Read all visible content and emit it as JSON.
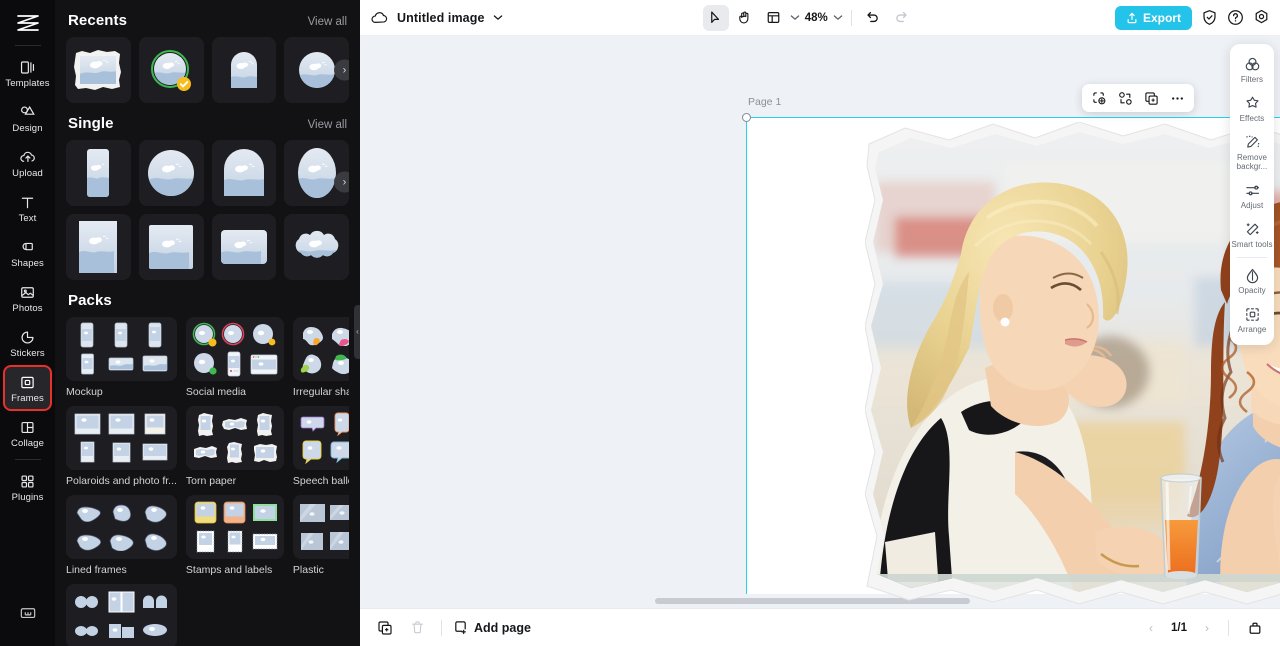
{
  "app": {
    "brand_icon": "logo-icon",
    "accent": "#24c3ea",
    "active_rail_highlight": "#e8312a"
  },
  "rail": {
    "items": [
      {
        "label": "Templates",
        "icon": "templates-icon",
        "active": false
      },
      {
        "label": "Design",
        "icon": "design-icon",
        "active": false
      },
      {
        "label": "Upload",
        "icon": "upload-cloud-icon",
        "active": false
      },
      {
        "label": "Text",
        "icon": "text-icon",
        "active": false
      },
      {
        "label": "Shapes",
        "icon": "shapes-icon",
        "active": false
      },
      {
        "label": "Photos",
        "icon": "photos-icon",
        "active": false
      },
      {
        "label": "Stickers",
        "icon": "stickers-icon",
        "active": false
      },
      {
        "label": "Frames",
        "icon": "frames-icon",
        "active": true
      },
      {
        "label": "Collage",
        "icon": "collage-icon",
        "active": false
      },
      {
        "label": "Plugins",
        "icon": "plugins-icon",
        "active": false
      }
    ],
    "bottom_icon": "keyboard-shortcuts-icon"
  },
  "panel": {
    "sections": [
      {
        "title": "Recents",
        "view_all": "View all",
        "items": [
          {
            "shape": "torn",
            "selected": false
          },
          {
            "shape": "circle-outline",
            "selected": true
          },
          {
            "shape": "arch",
            "selected": false
          },
          {
            "shape": "circle",
            "selected": false
          }
        ]
      },
      {
        "title": "Single",
        "view_all": "View all",
        "items": [
          {
            "shape": "rounded-tall"
          },
          {
            "shape": "circle"
          },
          {
            "shape": "arch"
          },
          {
            "shape": "oval"
          },
          {
            "shape": "square-tall"
          },
          {
            "shape": "square"
          },
          {
            "shape": "rounded-wide"
          },
          {
            "shape": "cloud"
          }
        ]
      }
    ],
    "packs_title": "Packs",
    "packs": [
      {
        "label": "Mockup"
      },
      {
        "label": "Social media"
      },
      {
        "label": "Irregular shape"
      },
      {
        "label": "Polaroids and photo fr..."
      },
      {
        "label": "Torn paper"
      },
      {
        "label": "Speech balloons"
      },
      {
        "label": "Lined frames"
      },
      {
        "label": "Stamps and labels"
      },
      {
        "label": "Plastic"
      }
    ]
  },
  "topbar": {
    "cloud_icon": "cloud-save-icon",
    "doc_title": "Untitled image",
    "title_chevron": "chevron-down-icon",
    "tools": [
      {
        "name": "select-tool",
        "icon": "cursor-icon",
        "selected": true
      },
      {
        "name": "hand-tool",
        "icon": "hand-icon",
        "selected": false
      },
      {
        "name": "layout-tool",
        "icon": "layout-icon",
        "selected": false
      }
    ],
    "zoom_value": "48%",
    "zoom_chevron": "chevron-down-icon",
    "undo": "undo-icon",
    "redo": "redo-icon",
    "export_label": "Export",
    "export_icon": "upload-icon",
    "shield_icon": "shield-check-icon",
    "help_icon": "help-circle-icon",
    "settings_icon": "gear-icon"
  },
  "canvas": {
    "page_label": "Page 1",
    "float_tools": [
      {
        "name": "crop-selection-tool",
        "icon": "crop-dashed-icon"
      },
      {
        "name": "replace-image-tool",
        "icon": "replace-icon"
      },
      {
        "name": "duplicate-tool",
        "icon": "duplicate-icon"
      },
      {
        "name": "more-options",
        "icon": "ellipsis-icon"
      }
    ],
    "rotate_icon": "rotate-icon",
    "selection_color": "#22d3ee",
    "image_description": "Two young women, one blonde and one redhead, smiling at a cafe table with two glasses of orange juice, inside a torn paper frame"
  },
  "right_panel": {
    "items": [
      {
        "label": "Filters",
        "icon": "filters-icon"
      },
      {
        "label": "Effects",
        "icon": "effects-icon"
      },
      {
        "label": "Remove backgr...",
        "icon": "remove-background-icon"
      },
      {
        "label": "Adjust",
        "icon": "adjust-sliders-icon"
      },
      {
        "label": "Smart tools",
        "icon": "magic-wand-icon"
      },
      {
        "label": "Opacity",
        "icon": "opacity-drop-icon"
      },
      {
        "label": "Arrange",
        "icon": "arrange-icon"
      }
    ]
  },
  "bottombar": {
    "duplicate_page_icon": "duplicate-page-icon",
    "delete_page_icon": "trash-icon",
    "add_page_label": "Add page",
    "add_page_icon": "add-page-icon",
    "prev_icon": "chevron-left-icon",
    "page_indicator": "1/1",
    "next_icon": "chevron-right-icon",
    "grid_view_icon": "pages-grid-icon"
  }
}
